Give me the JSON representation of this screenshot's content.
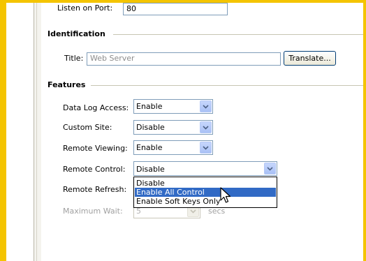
{
  "server": {
    "port_label": "Listen on Port:",
    "port_value": "80"
  },
  "identification": {
    "heading": "Identification",
    "title_label": "Title:",
    "title_value": "Web Server",
    "translate_button": "Translate..."
  },
  "features": {
    "heading": "Features",
    "data_log_access": {
      "label": "Data Log Access:",
      "value": "Enable"
    },
    "custom_site": {
      "label": "Custom Site:",
      "value": "Disable"
    },
    "remote_viewing": {
      "label": "Remote Viewing:",
      "value": "Enable"
    },
    "remote_control": {
      "label": "Remote Control:",
      "value": "Disable",
      "options": [
        "Disable",
        "Enable All Control",
        "Enable Soft Keys Only"
      ],
      "highlighted_option": "Enable All Control"
    },
    "remote_refresh": {
      "label": "Remote Refresh:"
    },
    "maximum_wait": {
      "label": "Maximum Wait:",
      "value": "5",
      "unit": "secs"
    }
  },
  "colors": {
    "frame": "#f4c400",
    "selection": "#316ac5",
    "input_border": "#7f9db9"
  },
  "icons": {
    "combo_arrow": "chevron-down-icon",
    "pointer": "mouse-pointer-icon"
  }
}
